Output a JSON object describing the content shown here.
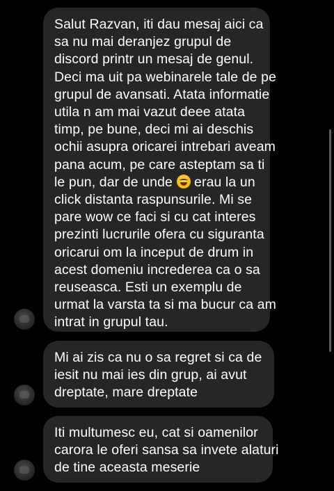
{
  "messages": [
    {
      "lines": [
        "Salut Razvan, iti dau mesaj aici ca",
        "sa nu mai deranjez grupul de",
        "discord printr un mesaj de genul.",
        "Deci ma uit pa webinarele tale de pe",
        "grupul de avansati. Atata informatie",
        "utila n am mai vazut deee atata",
        "timp, pe bune, deci mi ai deschis",
        "ochii asupra oricarei intrebari aveam",
        "pana acum, pe care asteptam sa ti",
        "click distanta raspunsurile. Mi se",
        "pare wow ce faci si cu cat interes",
        "prezinti lucrurile ofera cu siguranta",
        "oricarui om la inceput de drum in",
        "acest domeniu increderea ca o sa",
        "reuseasca. Esti un exemplu de",
        "urmat la varsta ta si ma bucur ca am",
        "intrat in grupul tau."
      ],
      "emoji_line": {
        "before": "le pun, dar de unde",
        "emoji_icon": "laughing-crying-emoji",
        "after": "erau la un"
      }
    },
    {
      "lines": [
        "Mi ai zis ca nu o sa regret si ca de",
        "iesit nu mai ies din grup, ai avut",
        "dreptate, mare dreptate"
      ]
    },
    {
      "lines": [
        "Iti multumesc eu, cat si oamenilor",
        "carora le oferi sansa sa invete alaturi",
        "de tine aceasta meserie"
      ]
    }
  ],
  "colors": {
    "background": "#000000",
    "bubble": "#262626",
    "text": "#ffffff"
  }
}
